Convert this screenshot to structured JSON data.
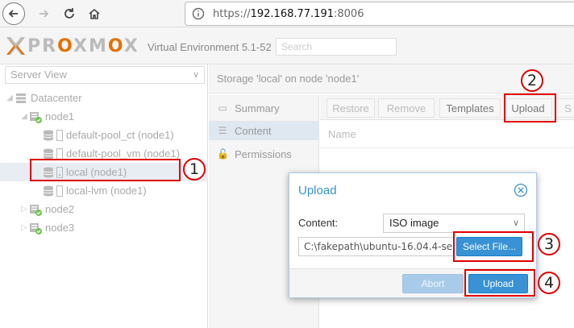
{
  "browser": {
    "url_scheme": "https://",
    "url_host": "192.168.77.191",
    "url_port": ":8006"
  },
  "header": {
    "logo_text_a": "PR",
    "logo_text_b": "O",
    "logo_text_c": "XM",
    "logo_text_d": "O",
    "logo_text_e": "X",
    "version": "Virtual Environment 5.1-52",
    "search_placeholder": "Search"
  },
  "sidebar": {
    "view_label": "Server View",
    "tree": [
      {
        "label": "Datacenter"
      },
      {
        "label": "node1"
      },
      {
        "label": "default-pool_ct (node1)"
      },
      {
        "label": "default-pool_vm (node1)"
      },
      {
        "label": "local (node1)"
      },
      {
        "label": "local-lvm (node1)"
      },
      {
        "label": "node2"
      },
      {
        "label": "node3"
      }
    ]
  },
  "content": {
    "title": "Storage 'local' on node 'node1'",
    "subnav": [
      {
        "label": "Summary"
      },
      {
        "label": "Content"
      },
      {
        "label": "Permissions"
      }
    ],
    "toolbar": {
      "restore": "Restore",
      "remove": "Remove",
      "templates": "Templates",
      "upload": "Upload",
      "overflow": "S"
    },
    "grid_column": "Name"
  },
  "dialog": {
    "title": "Upload",
    "content_label": "Content:",
    "content_value": "ISO image",
    "file_value": "C:\\fakepath\\ubuntu-16.04.4-ser",
    "select_file": "Select File...",
    "abort": "Abort",
    "upload": "Upload"
  },
  "annotations": [
    "1",
    "2",
    "3",
    "4"
  ],
  "colors": {
    "accent": "#3892d4",
    "logo_orange": "#e57000",
    "annotation_red": "#e00000"
  }
}
